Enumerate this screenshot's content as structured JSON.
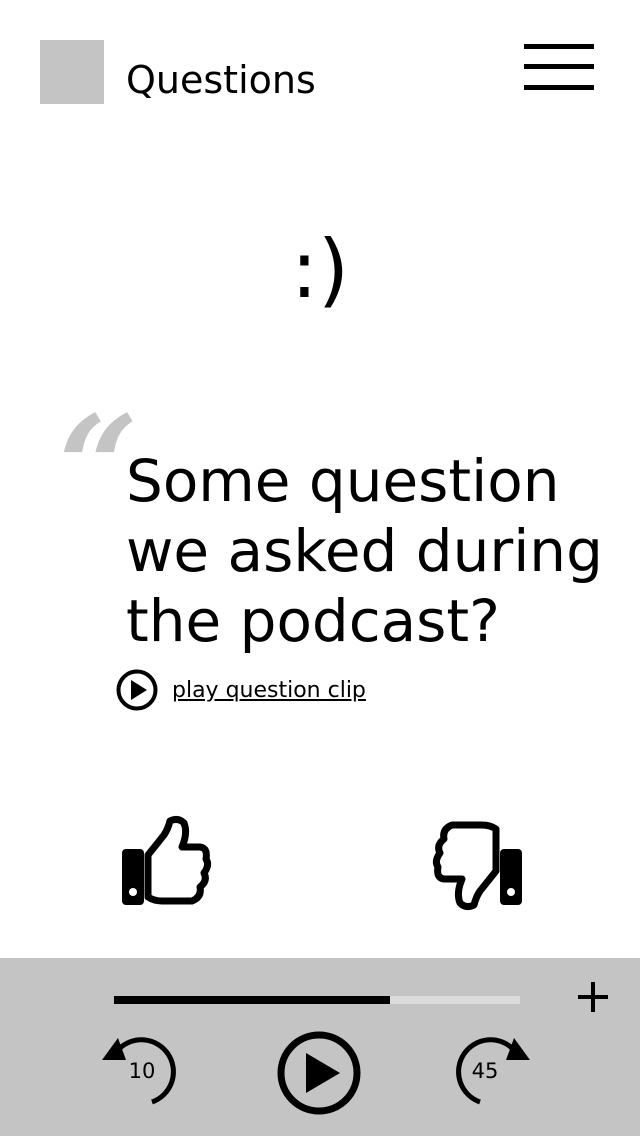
{
  "header": {
    "title": "Questions",
    "logo_color": "#c4c4c4",
    "menu_icon": "hamburger-menu-icon"
  },
  "hero": {
    "emoticon": ":)"
  },
  "question": {
    "quote_mark": "“",
    "text": "Some question we asked during the podcast?",
    "play_clip_label": "play question clip",
    "play_icon": "play-circle-icon"
  },
  "feedback": {
    "like_icon": "thumbs-up-icon",
    "dislike_icon": "thumbs-down-icon"
  },
  "player": {
    "background": "#c4c4c4",
    "progress_fraction": 0.68,
    "add_icon": "plus-icon",
    "rewind_seconds": "10",
    "forward_seconds": "45",
    "play_icon": "play-circle-icon"
  }
}
